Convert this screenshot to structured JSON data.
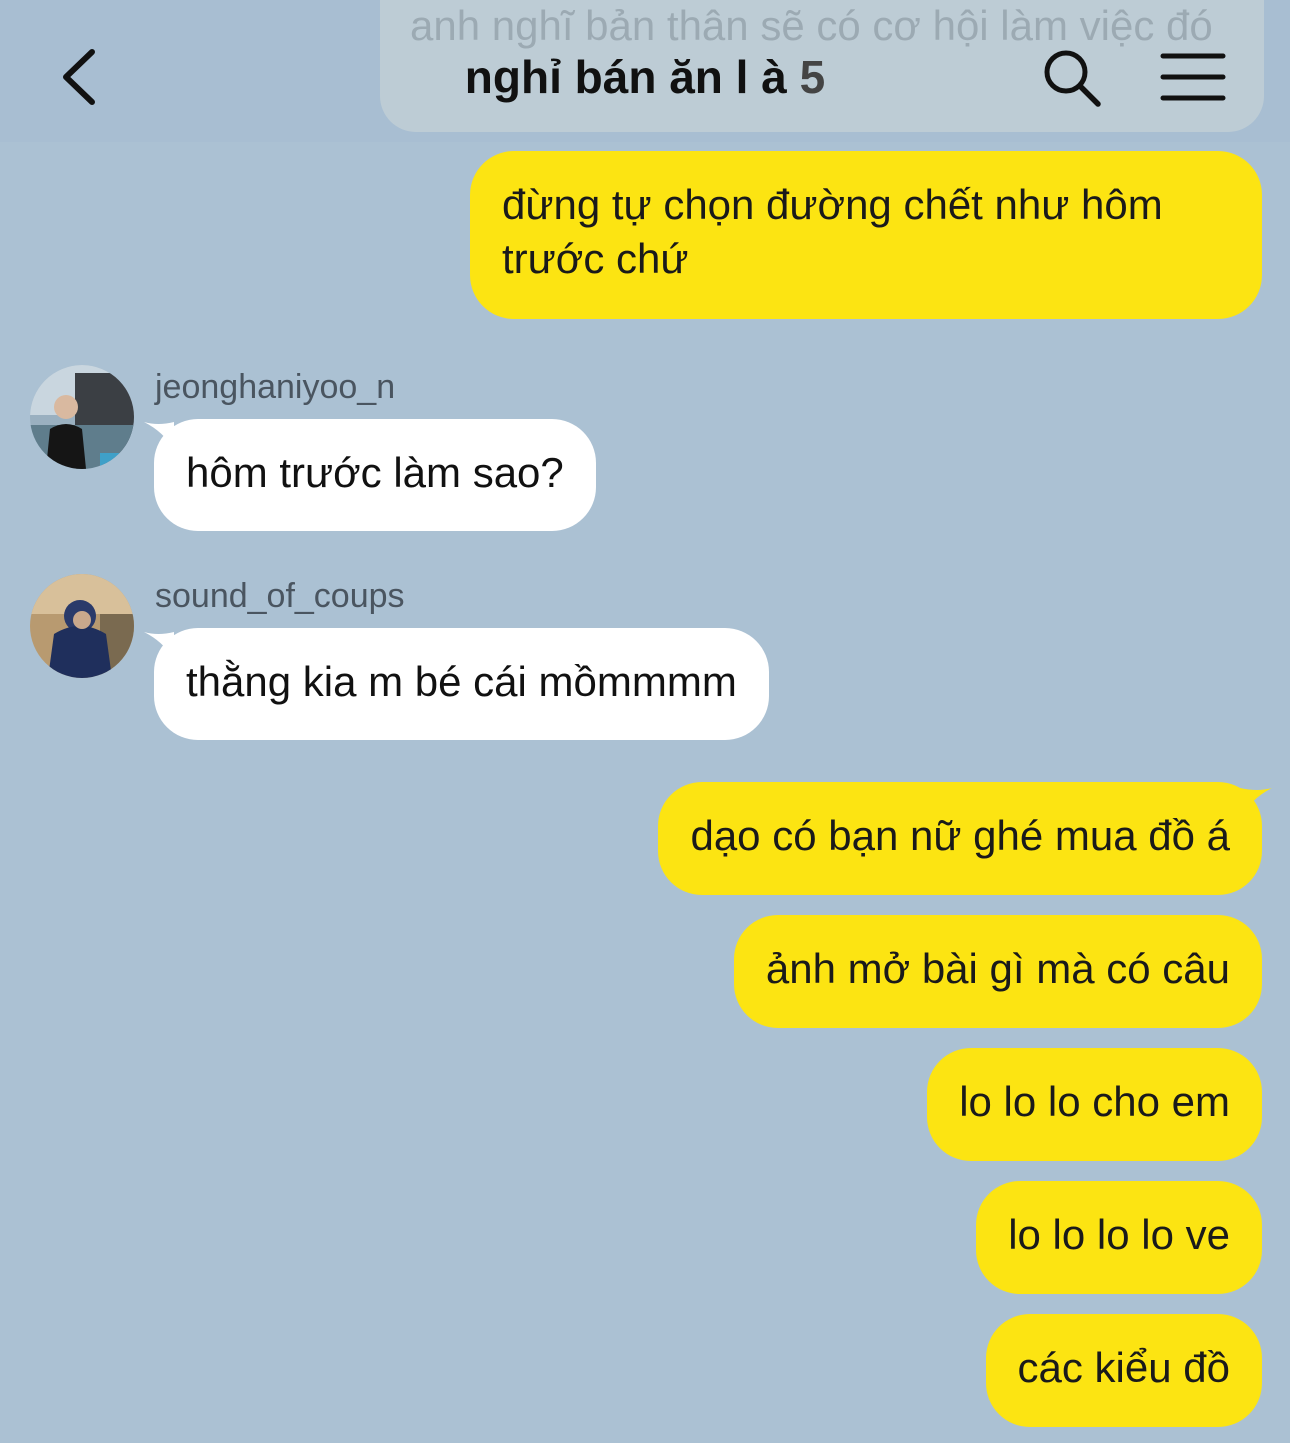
{
  "header": {
    "previous_message_partial": "anh nghĩ bản thân sẽ có cơ hội làm việc đó",
    "title": "nghỉ bán ăn l à",
    "member_count": "5"
  },
  "messages": [
    {
      "from": "me",
      "text": "đừng tự chọn đường chết như hôm trước chứ"
    },
    {
      "from": "them",
      "sender": "jeonghaniyoo_n",
      "text": "hôm trước làm sao?"
    },
    {
      "from": "them",
      "sender": "sound_of_coups",
      "text": "thằng kia m bé cái mồmmmm"
    },
    {
      "from": "me",
      "text": "dạo có bạn nữ ghé mua đồ á"
    },
    {
      "from": "me",
      "text": "ảnh mở bài gì mà có câu"
    },
    {
      "from": "me",
      "text": "lo lo lo cho em"
    },
    {
      "from": "me",
      "text": "lo lo lo lo ve"
    },
    {
      "from": "me",
      "text": "các kiểu đồ"
    }
  ],
  "icons": {
    "back": "chevron-left-icon",
    "search": "search-icon",
    "menu": "hamburger-menu-icon"
  },
  "colors": {
    "background": "#abc1d3",
    "my_bubble": "#fce412",
    "their_bubble": "#ffffff"
  }
}
